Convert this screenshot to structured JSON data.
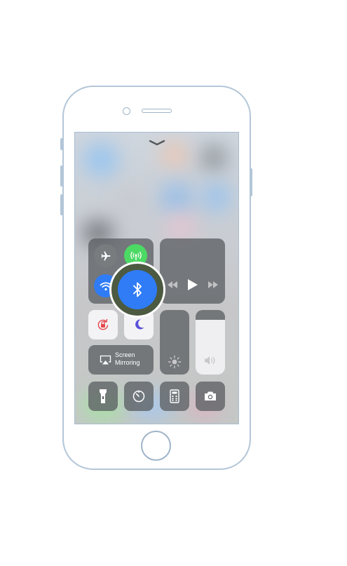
{
  "control_center": {
    "screen_mirroring": {
      "line1": "Screen",
      "line2": "Mirroring"
    }
  },
  "colors": {
    "bluetooth_active": "#2f7cf6",
    "wifi_active": "#2f7cf6",
    "cellular_active": "#4cd964",
    "rotation_lock": "#e5484d",
    "do_not_disturb": "#5a50d8",
    "phone_outline": "#b3c6d8"
  },
  "icons": [
    "chevron-down-icon",
    "airplane-icon",
    "cellular-icon",
    "wifi-icon",
    "bluetooth-icon",
    "rewind-icon",
    "play-icon",
    "fast-forward-icon",
    "rotation-lock-icon",
    "moon-icon",
    "airplay-icon",
    "brightness-icon",
    "volume-icon",
    "flashlight-icon",
    "timer-icon",
    "calculator-icon",
    "camera-icon"
  ],
  "sliders": {
    "brightness_level": 0.0,
    "volume_level": 0.85
  }
}
